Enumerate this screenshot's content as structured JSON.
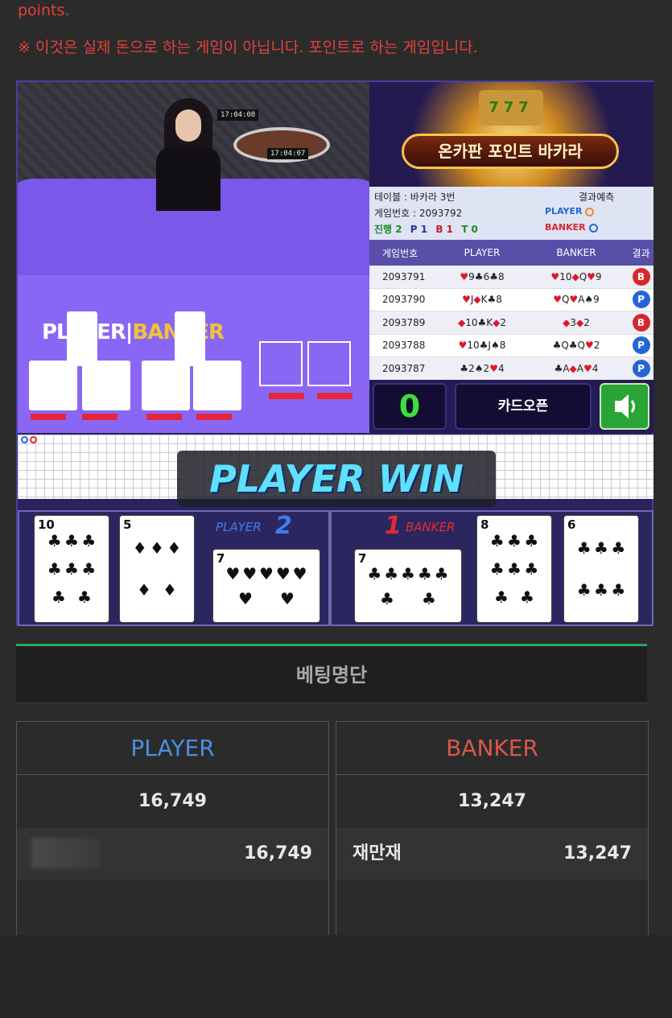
{
  "notice": {
    "line1": "points.",
    "line2": "※ 이것은 실제 돈으로 하는 게임이 아닙니다. 포인트로 하는 게임입니다."
  },
  "video": {
    "clock_main": "17:04:07",
    "clock_small": "17:04:08",
    "label_player": "PLAYER",
    "label_banker": "BANKER"
  },
  "banner": {
    "slot_text": "777",
    "title": "온카판 포인트 바카라"
  },
  "info": {
    "table": "테이블 : 바카라 3번",
    "game_no": "게임번호 : 2093792",
    "progress_label": "진행 2",
    "progress_p": "P 1",
    "progress_b": "B 1",
    "progress_t": "T 0",
    "prediction_label": "결과예측",
    "pred_player": "PLAYER",
    "pred_banker": "BANKER"
  },
  "history": {
    "headers": [
      "게임번호",
      "PLAYER",
      "BANKER",
      "결과"
    ],
    "rows": [
      {
        "no": "2093791",
        "player": "♥9♣6♣8",
        "banker": "♥10◆Q♥9",
        "result": "B"
      },
      {
        "no": "2093790",
        "player": "♥J◆K♣8",
        "banker": "♥Q♥A♠9",
        "result": "P"
      },
      {
        "no": "2093789",
        "player": "◆10♣K◆2",
        "banker": "◆3◆2",
        "result": "B"
      },
      {
        "no": "2093788",
        "player": "♥10♣J♠8",
        "banker": "♣Q♣Q♥2",
        "result": "P"
      },
      {
        "no": "2093787",
        "player": "♣2♠2♥4",
        "banker": "♣A◆A♥4",
        "result": "P"
      }
    ],
    "colors": {
      "B": "#d8262d",
      "P": "#2466d8"
    }
  },
  "controls": {
    "timer": "0",
    "open_label": "카드오픈",
    "sound_icon": "speaker-icon"
  },
  "result": {
    "win_text": "PLAYER WIN",
    "player_label": "PLAYER",
    "player_score": "2",
    "banker_label": "BANKER",
    "banker_score": "1",
    "player_cards": [
      {
        "rank": "10",
        "suit": "♣"
      },
      {
        "rank": "5",
        "suit": "♦"
      },
      {
        "rank": "7",
        "suit": "♥"
      }
    ],
    "banker_cards": [
      {
        "rank": "7",
        "suit": "♣"
      },
      {
        "rank": "8",
        "suit": "♣"
      },
      {
        "rank": "6",
        "suit": "♣"
      }
    ]
  },
  "bets": {
    "title": "베팅명단",
    "player": {
      "label": "PLAYER",
      "total": "16,749",
      "entry_amount": "16,749",
      "color": "#4a90e2"
    },
    "banker": {
      "label": "BANKER",
      "total": "13,247",
      "entry_name": "재만재",
      "entry_amount": "13,247",
      "color": "#d9584a"
    }
  }
}
